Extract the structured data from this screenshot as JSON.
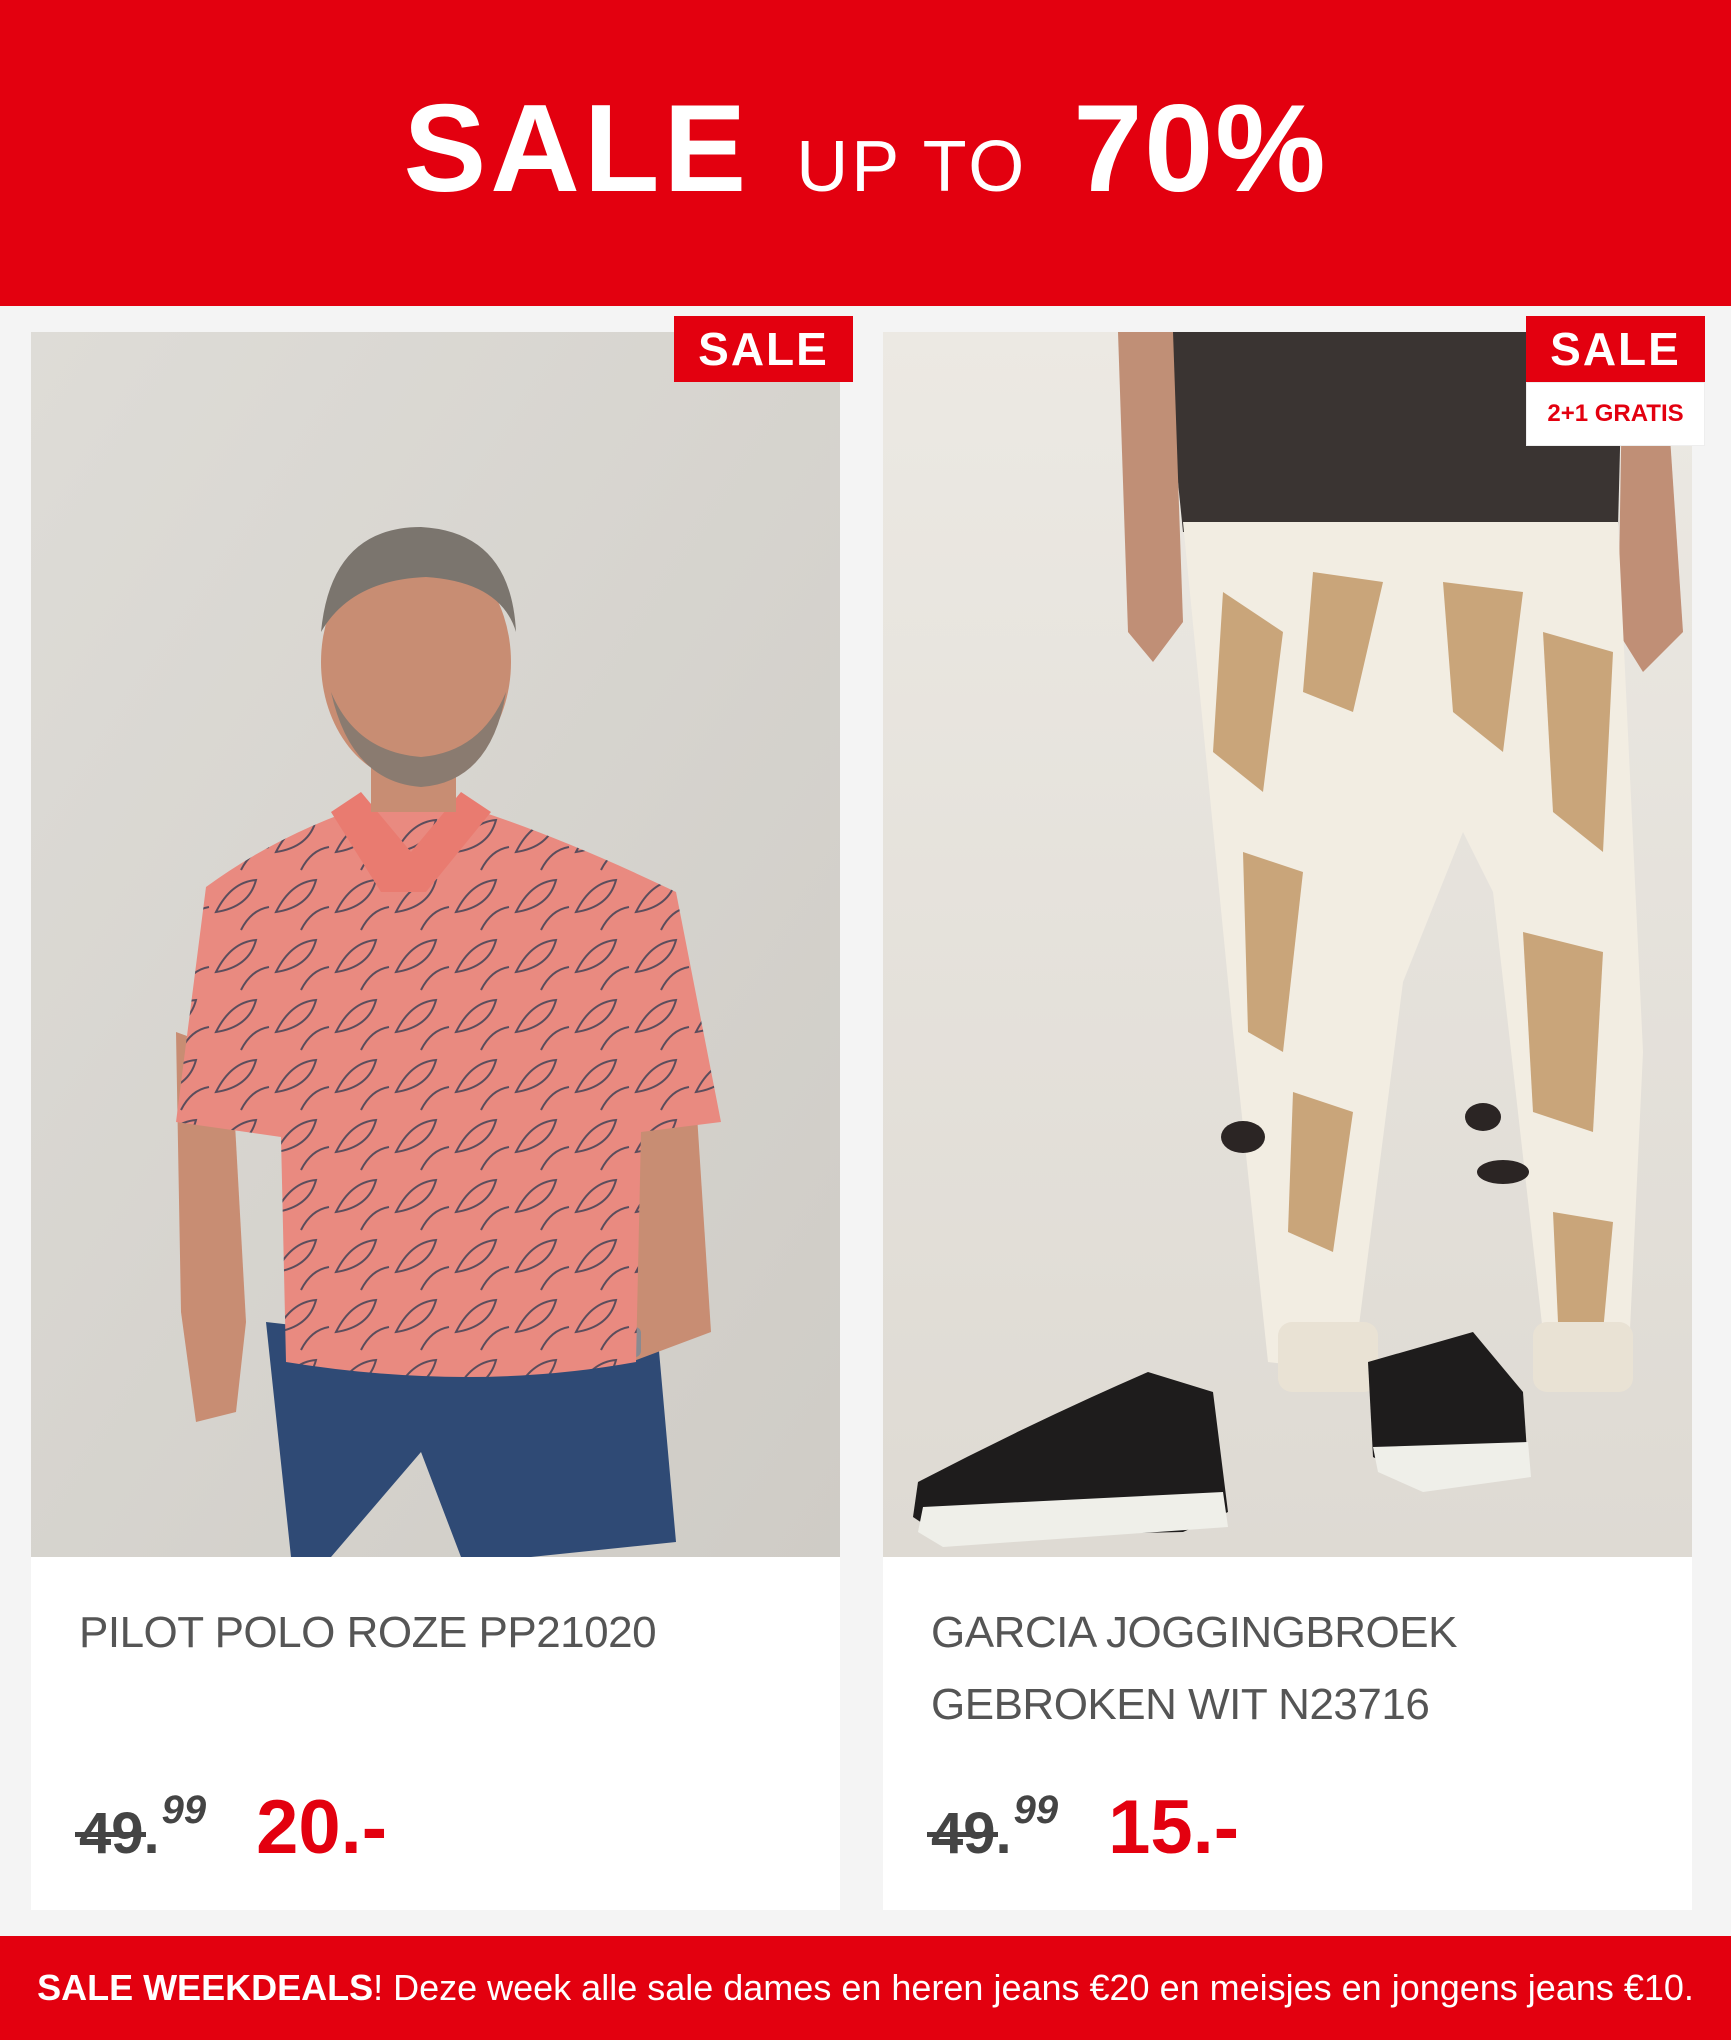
{
  "banner": {
    "word_sale": "SALE",
    "word_upto": "UP TO",
    "word_percent": "70%",
    "color": "#e3000f"
  },
  "products": [
    {
      "badge": "SALE",
      "image_desc_icon": "man-pink-floral-polo-photo",
      "title": "PILOT POLO ROZE PP21020",
      "old_price_main": "49.",
      "old_price_cents": "99",
      "new_price": "20.-"
    },
    {
      "badge": "SALE",
      "promo": "2+1 GRATIS",
      "image_desc_icon": "tie-dye-joggers-photo",
      "title": "GARCIA JOGGINGBROEK GEBROKEN WIT N23716",
      "old_price_main": "49.",
      "old_price_cents": "99",
      "new_price": "15.-"
    }
  ],
  "footer": {
    "bold": "SALE WEEKDEALS",
    "text": "! Deze week alle sale dames en heren jeans €20 en meisjes en jongens jeans €10."
  }
}
